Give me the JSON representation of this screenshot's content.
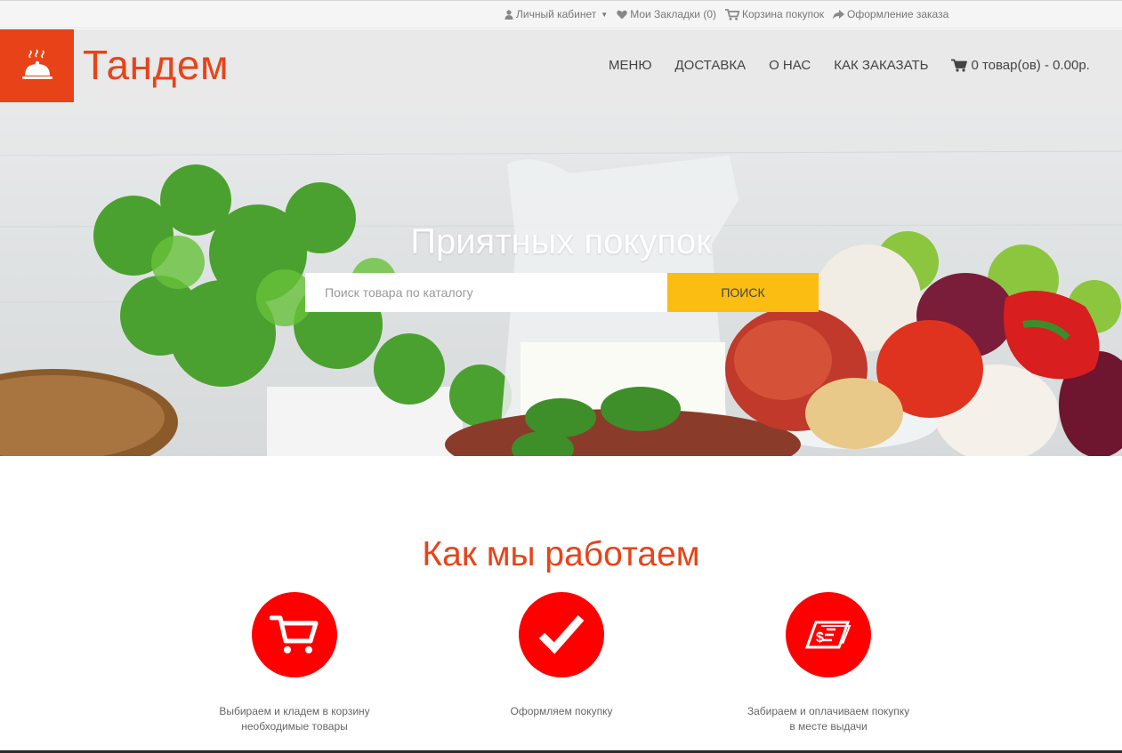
{
  "topbar": {
    "account": "Личный кабинет",
    "bookmarks": "Мои Закладки (0)",
    "cart": "Корзина покупок",
    "checkout": "Оформление заказа"
  },
  "header": {
    "brand": "Тандем",
    "nav": {
      "menu": "МЕНЮ",
      "delivery": "ДОСТАВКА",
      "about": "О НАС",
      "how_to_order": "КАК ЗАКАЗАТЬ",
      "cart_summary": "0 товар(ов) - 0.00р."
    }
  },
  "hero": {
    "title": "Приятных покупок",
    "search_placeholder": "Поиск товара по каталогу",
    "search_button": "ПОИСК"
  },
  "how": {
    "title": "Как мы работаем",
    "steps": [
      {
        "icon": "cart-icon",
        "line1": "Выбираем и кладем в корзину",
        "line2": "необходимые товары"
      },
      {
        "icon": "checkmark-icon",
        "line1": "Оформляем покупку",
        "line2": ""
      },
      {
        "icon": "money-icon",
        "line1": "Забираем и оплачиваем покупку",
        "line2": "в месте выдачи"
      }
    ]
  },
  "colors": {
    "brand": "#e84318",
    "accent": "#fbbd11",
    "icon_circle": "#fe0000"
  }
}
